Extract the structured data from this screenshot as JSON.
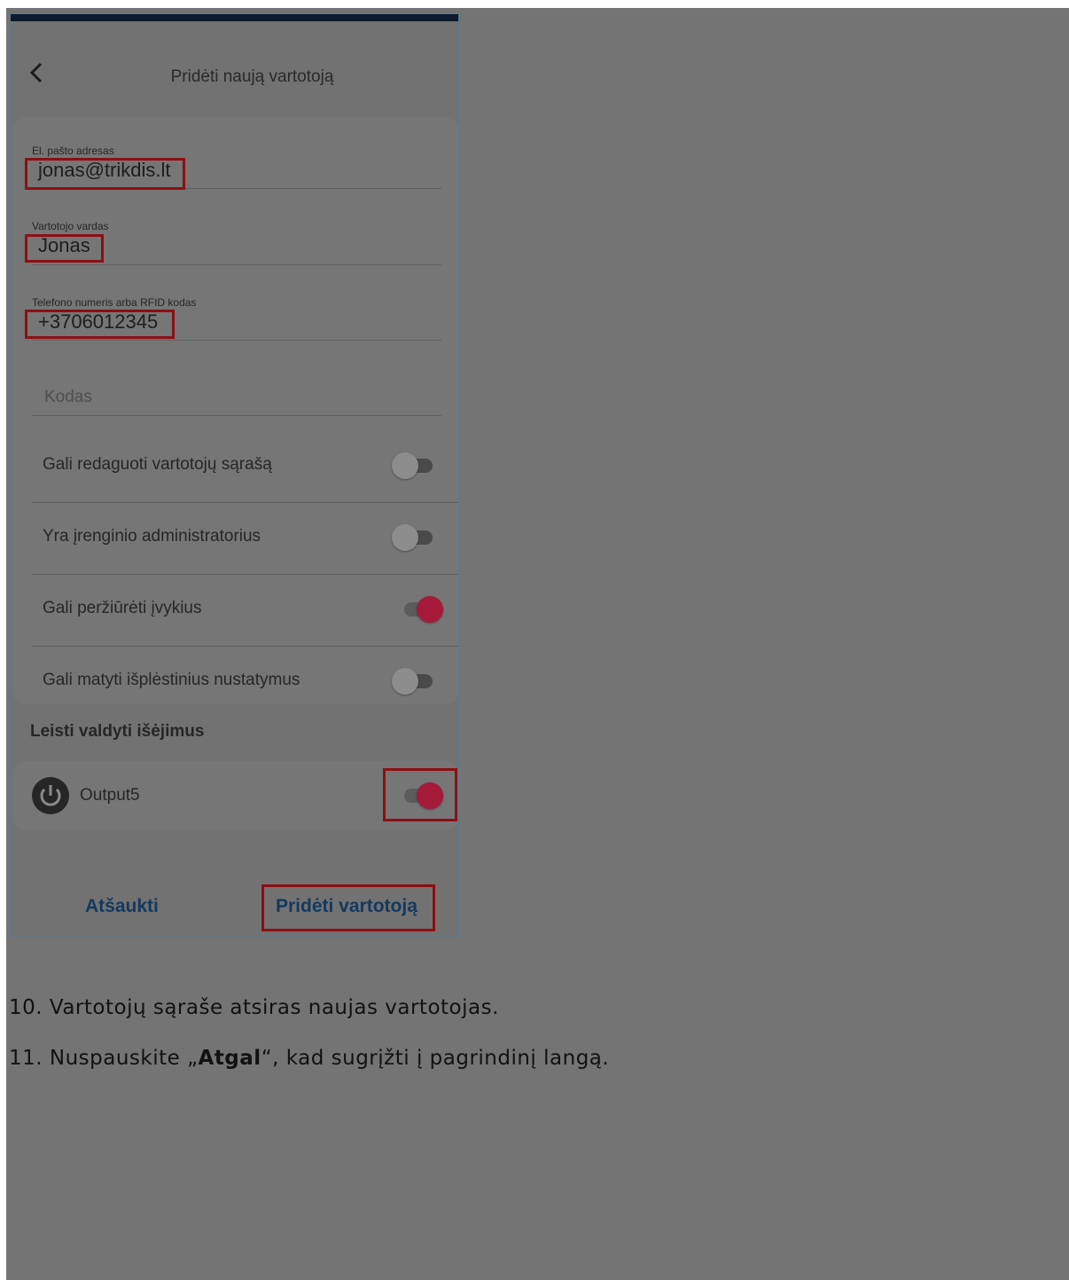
{
  "header": {
    "back_icon": "chevron-left-icon",
    "title": "Pridėti naują vartotoją"
  },
  "fields": {
    "email": {
      "label": "El. pašto adresas",
      "value": "jonas@trikdis.lt"
    },
    "username": {
      "label": "Vartotojo vardas",
      "value": "Jonas"
    },
    "phone": {
      "label": "Telefono numeris arba RFID kodas",
      "value": "+3706012345"
    },
    "code": {
      "placeholder": "Kodas",
      "value": ""
    }
  },
  "permissions": [
    {
      "label": "Gali redaguoti vartotojų sąrašą",
      "enabled": false
    },
    {
      "label": "Yra įrenginio administratorius",
      "enabled": false
    },
    {
      "label": "Gali peržiūrėti įvykius",
      "enabled": true
    },
    {
      "label": "Gali matyti išplėstinius nustatymus",
      "enabled": false
    }
  ],
  "outputs": {
    "section_title": "Leisti valdyti išėjimus",
    "items": [
      {
        "icon": "power-icon",
        "label": "Output5",
        "enabled": true
      }
    ]
  },
  "footer": {
    "cancel_label": "Atšaukti",
    "add_label": "Pridėti vartotoją"
  },
  "instructions": {
    "step10": "10. Vartotojų sąraše atsiras naujas vartotojas.",
    "step11_prefix": "11. Nuspauskite „",
    "step11_bold": "Atgal",
    "step11_suffix": "“, kad sugrįžti į pagrindinį langą."
  },
  "colors": {
    "overlay_gray": "#747474",
    "highlight_red": "#8c0f14",
    "toggle_on": "#a51a3a",
    "button_text": "#13395e"
  }
}
